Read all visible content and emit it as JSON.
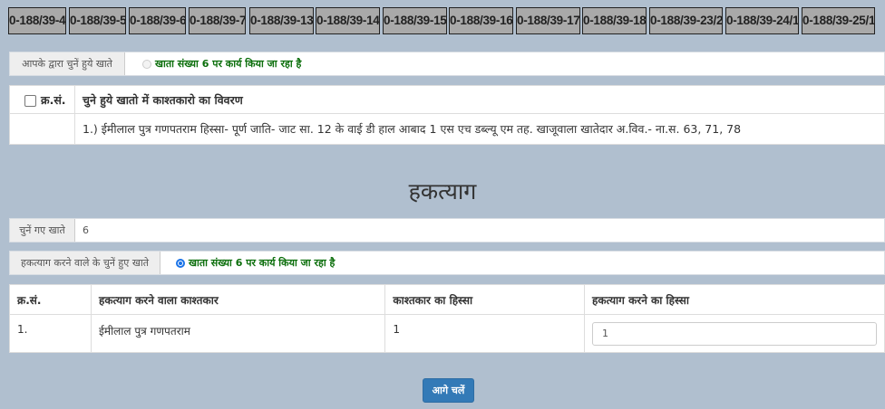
{
  "tabs": [
    "0-188/39-4",
    "0-188/39-5",
    "0-188/39-6",
    "0-188/39-7",
    "0-188/39-13",
    "0-188/39-14",
    "0-188/39-15",
    "0-188/39-16",
    "0-188/39-17",
    "0-188/39-18",
    "0-188/39-23/2",
    "0-188/39-24/1",
    "0-188/39-25/1"
  ],
  "selected_accounts": {
    "label": "आपके द्वारा चुनें हुये खाते",
    "status": "खाता संख्या 6 पर कार्य किया जा रहा है"
  },
  "details_table": {
    "col_serial": "क्र.सं.",
    "col_details": "चुने हुये खातो में काश्तकारो का विवरण",
    "row_text": "1.) ईमीलाल पुत्र गणपतराम हिस्सा- पूर्ण जाति- जाट सा. 12 के वाई डी हाल आबाद 1 एस एच डब्ल्यू एम तह. खाजूवाला खातेदार अ.विव.- ना.स. 63, 71, 78"
  },
  "section_title": "हकत्याग",
  "chosen_accounts": {
    "label": "चुनें गए खाते",
    "value": "6"
  },
  "relinquisher_accounts": {
    "label": "हकत्याग करने वाले के चुनें हुए खाते",
    "status": "खाता संख्या 6 पर कार्य किया जा रहा है"
  },
  "relinquish_table": {
    "headers": [
      "क्र.सं.",
      "हकत्याग करने वाला काश्तकार",
      "काश्तकार का हिस्सा",
      "हकत्याग करने का हिस्सा"
    ],
    "rows": [
      {
        "serial": "1.",
        "name": "ईमीलाल पुत्र गणपतराम",
        "share": "1",
        "relinquish_share": "1"
      }
    ]
  },
  "next_button": "आगे चलें"
}
